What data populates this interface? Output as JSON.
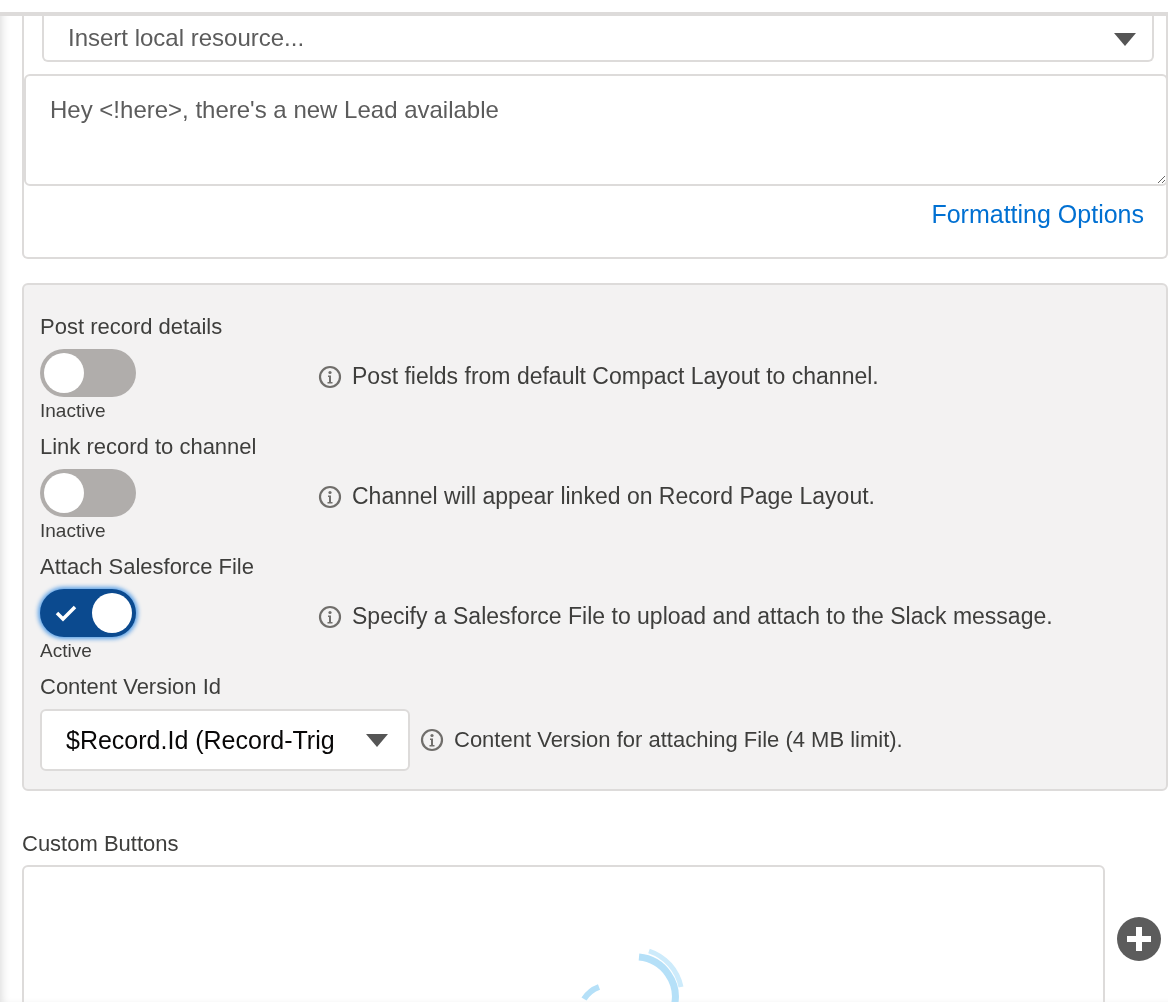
{
  "resource_picker": {
    "placeholder": "Insert local resource..."
  },
  "message": {
    "value": "Hey <!here>, there's a new Lead available"
  },
  "formatting_link": "Formatting Options",
  "options": [
    {
      "label": "Post record details",
      "on": false,
      "status": "Inactive",
      "help": "Post fields from default Compact Layout to channel."
    },
    {
      "label": "Link record to channel",
      "on": false,
      "status": "Inactive",
      "help": "Channel will appear linked on Record Page Layout."
    },
    {
      "label": "Attach Salesforce File",
      "on": true,
      "status": "Active",
      "help": "Specify a Salesforce File to upload and attach to the Slack message."
    }
  ],
  "content_version": {
    "label": "Content Version Id",
    "value": "$Record.Id (Record-Trig",
    "help": "Content Version for attaching File (4 MB limit)."
  },
  "custom_buttons": {
    "label": "Custom Buttons"
  }
}
